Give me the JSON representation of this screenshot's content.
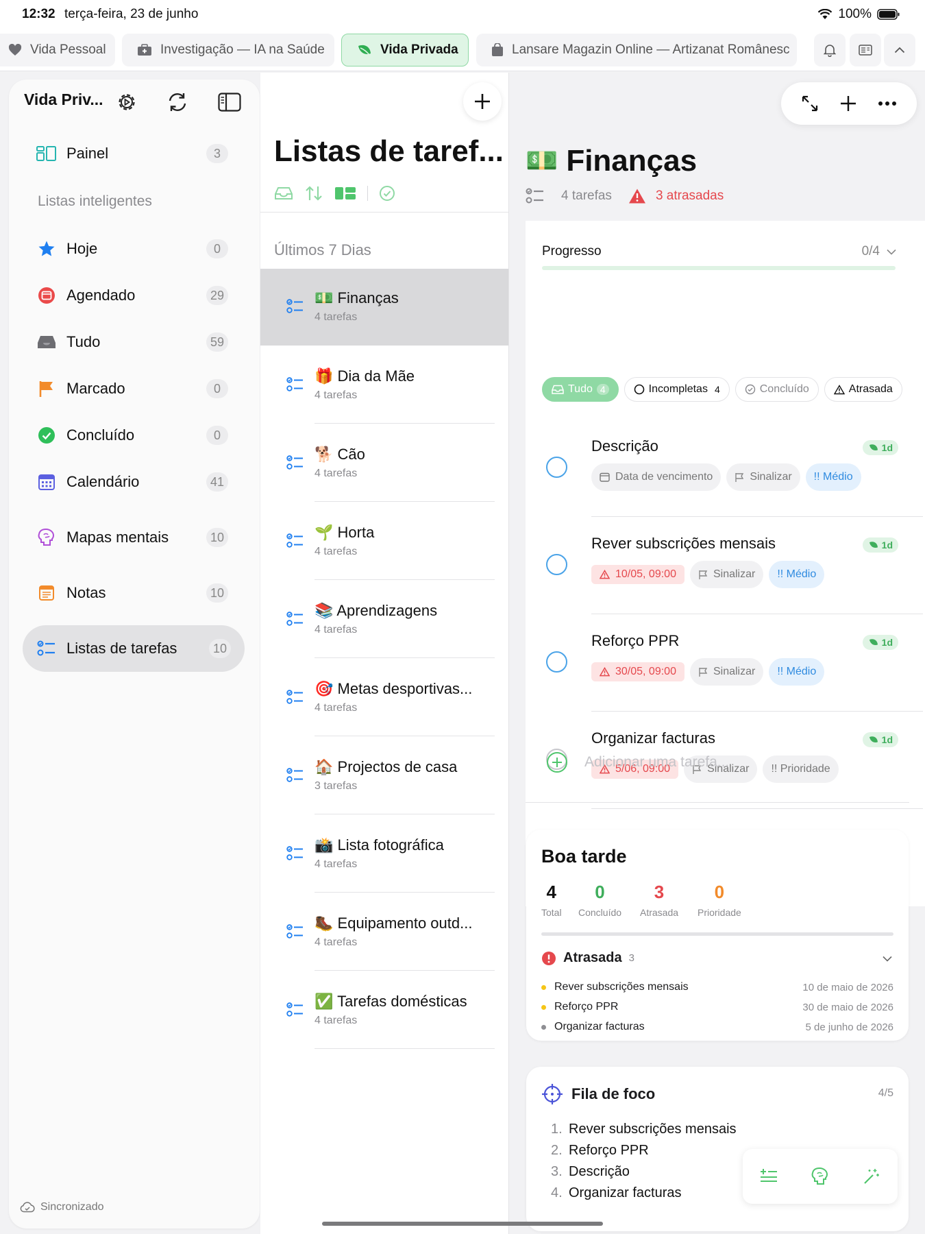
{
  "status": {
    "time": "12:32",
    "date": "terça-feira, 23 de junho",
    "battery": "100%"
  },
  "tabs": [
    {
      "label": "Vida Pessoal",
      "icon": "heart-icon"
    },
    {
      "label": "Investigação — IA na Saúde",
      "icon": "medical-bag-icon"
    },
    {
      "label": "Vida Privada",
      "icon": "leaf-icon",
      "active": true
    },
    {
      "label": "Lansare Magazin Online — Artizanat Românesc",
      "icon": "shopping-bag-icon"
    }
  ],
  "sidebar": {
    "title": "Vida Priv...",
    "section_label": "Listas inteligentes",
    "sync_status": "Sincronizado",
    "items": [
      {
        "label": "Painel",
        "count": "3",
        "icon": "dashboard-icon"
      },
      {
        "label": "Hoje",
        "count": "0",
        "icon": "star-icon"
      },
      {
        "label": "Agendado",
        "count": "29",
        "icon": "calendar-clock-icon"
      },
      {
        "label": "Tudo",
        "count": "59",
        "icon": "inbox-icon"
      },
      {
        "label": "Marcado",
        "count": "0",
        "icon": "flag-icon"
      },
      {
        "label": "Concluído",
        "count": "0",
        "icon": "check-circle-icon"
      },
      {
        "label": "Calendário",
        "count": "41",
        "icon": "calendar-icon"
      },
      {
        "label": "Mapas mentais",
        "count": "10",
        "icon": "brain-icon"
      },
      {
        "label": "Notas",
        "count": "10",
        "icon": "notes-icon"
      },
      {
        "label": "Listas de tarefas",
        "count": "10",
        "icon": "checklist-icon",
        "active": true
      }
    ]
  },
  "middle": {
    "title": "Listas de taref...",
    "section": "Últimos 7 Dias",
    "lists": [
      {
        "emoji": "💵",
        "name": "Finanças",
        "sub": "4 tarefas",
        "active": true
      },
      {
        "emoji": "🎁",
        "name": "Dia da Mãe",
        "sub": "4 tarefas"
      },
      {
        "emoji": "🐕",
        "name": "Cão",
        "sub": "4 tarefas"
      },
      {
        "emoji": "🌱",
        "name": "Horta",
        "sub": "4 tarefas"
      },
      {
        "emoji": "📚",
        "name": "Aprendizagens",
        "sub": "4 tarefas"
      },
      {
        "emoji": "🎯",
        "name": "Metas desportivas...",
        "sub": "4 tarefas"
      },
      {
        "emoji": "🏠",
        "name": "Projectos de casa",
        "sub": "3 tarefas"
      },
      {
        "emoji": "📸",
        "name": "Lista fotográfica",
        "sub": "4 tarefas"
      },
      {
        "emoji": "🥾",
        "name": "Equipamento outd...",
        "sub": "4 tarefas"
      },
      {
        "emoji": "✅",
        "name": "Tarefas domésticas",
        "sub": "4 tarefas"
      }
    ]
  },
  "detail": {
    "emoji": "💵",
    "title": "Finanças",
    "task_count": "4 tarefas",
    "overdue": "3 atrasadas",
    "progress_label": "Progresso",
    "progress_text": "0/4",
    "progress_fraction": 0,
    "filters": {
      "all": "Tudo",
      "all_count": "4",
      "incomplete": "Incompletas",
      "incomplete_count": "4",
      "done": "Concluído",
      "overdue": "Atrasada"
    },
    "tasks": [
      {
        "title": "Descrição",
        "tag": "1d",
        "due": "Data de vencimento",
        "flag": "Sinalizar",
        "priority": "!! Médio",
        "overdue": false
      },
      {
        "title": "Rever subscrições mensais",
        "tag": "1d",
        "due": "10/05, 09:00",
        "flag": "Sinalizar",
        "priority": "!! Médio",
        "overdue": true
      },
      {
        "title": "Reforço PPR",
        "tag": "1d",
        "due": "30/05, 09:00",
        "flag": "Sinalizar",
        "priority": "!! Médio",
        "overdue": true
      },
      {
        "title": "Organizar facturas",
        "tag": "1d",
        "due": "5/06, 09:00",
        "flag": "Sinalizar",
        "priority": "!! Prioridade",
        "overdue": true
      }
    ],
    "add_placeholder": "Adicionar uma tarefa..."
  },
  "summary": {
    "greeting": "Boa tarde",
    "stats": [
      {
        "value": "4",
        "label": "Total",
        "color": "#111111"
      },
      {
        "value": "0",
        "label": "Concluído",
        "color": "#3fae5c"
      },
      {
        "value": "3",
        "label": "Atrasada",
        "color": "#e5484d"
      },
      {
        "value": "0",
        "label": "Prioridade",
        "color": "#f28b2b"
      }
    ],
    "overdue_title": "Atrasada",
    "overdue_count": "3",
    "overdue_items": [
      {
        "name": "Rever subscrições mensais",
        "date": "10 de maio de 2026",
        "dot": "#f5c518"
      },
      {
        "name": "Reforço PPR",
        "date": "30 de maio de 2026",
        "dot": "#f5c518"
      },
      {
        "name": "Organizar facturas",
        "date": "5 de junho de 2026",
        "dot": "#8e8e93"
      }
    ]
  },
  "focus": {
    "title": "Fila de foco",
    "count": "4/5",
    "items": [
      {
        "n": "1.",
        "name": "Rever subscrições mensais"
      },
      {
        "n": "2.",
        "name": "Reforço PPR"
      },
      {
        "n": "3.",
        "name": "Descrição"
      },
      {
        "n": "4.",
        "name": "Organizar facturas"
      }
    ]
  },
  "colors": {
    "accent_green": "#4fc56c",
    "overdue_red": "#e5484d",
    "blue": "#2f8be0"
  }
}
